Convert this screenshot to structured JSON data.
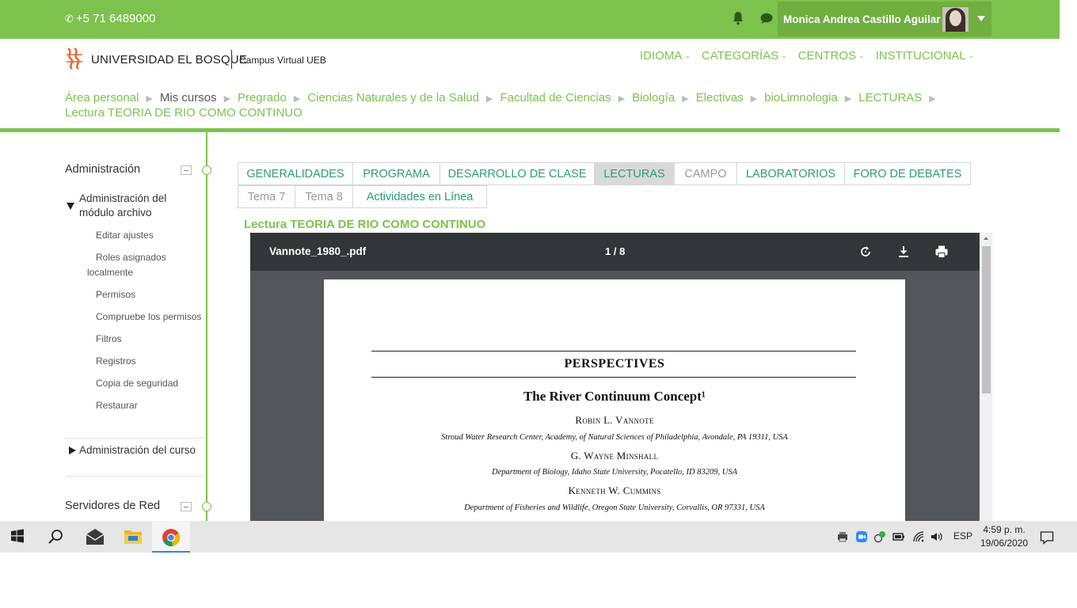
{
  "topbar": {
    "phone": "+5 71 6489000",
    "user_name": "Monica Andrea Castillo Aguilar",
    "bell_icon": "bell-icon",
    "chat_icon": "chat-bubble-icon"
  },
  "header": {
    "logo_text_1": "UNIVERSIDAD",
    "logo_text_2": "EL BOSQUE",
    "campus": "Campus Virtual UEB",
    "nav": [
      {
        "label": "IDIOMA"
      },
      {
        "label": "CATEGORÍAS"
      },
      {
        "label": "CENTROS"
      },
      {
        "label": "INSTITUCIONAL"
      }
    ]
  },
  "breadcrumb": [
    {
      "label": "Área personal",
      "link": true
    },
    {
      "label": "Mis cursos",
      "link": false
    },
    {
      "label": "Pregrado",
      "link": true
    },
    {
      "label": "Ciencias Naturales y de la Salud",
      "link": true
    },
    {
      "label": "Facultad de Ciencias",
      "link": true
    },
    {
      "label": "Biología",
      "link": true
    },
    {
      "label": "Electivas",
      "link": true
    },
    {
      "label": "bioLimnologia",
      "link": true
    },
    {
      "label": "LECTURAS",
      "link": true
    },
    {
      "label": "Lectura TEORIA DE RIO COMO CONTINUO",
      "link": true
    }
  ],
  "sidebar": {
    "admin_title": "Administración",
    "module_admin": "Administración del módulo archivo",
    "module_links": [
      "Editar ajustes",
      "Roles asignados localmente",
      "Permisos",
      "Compruebe los permisos",
      "Filtros",
      "Registros",
      "Copia de seguridad",
      "Restaurar"
    ],
    "course_admin": "Administración del curso",
    "network_title": "Servidores de Red"
  },
  "tabs": {
    "row1": [
      {
        "label": "GENERALIDADES",
        "state": "normal"
      },
      {
        "label": "PROGRAMA",
        "state": "normal"
      },
      {
        "label": "DESARROLLO DE CLASE",
        "state": "normal"
      },
      {
        "label": "LECTURAS",
        "state": "active"
      },
      {
        "label": "CAMPO",
        "state": "disabled"
      },
      {
        "label": "LABORATORIOS",
        "state": "normal"
      },
      {
        "label": "FORO DE DEBATES",
        "state": "normal"
      }
    ],
    "row2": [
      {
        "label": "Tema 7",
        "state": "disabled"
      },
      {
        "label": "Tema 8",
        "state": "disabled"
      },
      {
        "label": "Actividades en Línea",
        "state": "normal"
      }
    ]
  },
  "page_title": "Lectura TEORIA DE RIO COMO CONTINUO",
  "pdf": {
    "file_name": "Vannote_1980_.pdf",
    "page_indicator": "1 / 8",
    "buttons": [
      "rotate-icon",
      "download-icon",
      "print-icon"
    ],
    "section": "PERSPECTIVES",
    "title": "The River Continuum Concept¹",
    "authors": [
      {
        "name": "Robin L. Vannote",
        "affiliation": "Stroud Water Research Center, Academy, of Natural Sciences of Philadelphia, Avondale, PA 19311, USA"
      },
      {
        "name": "G. Wayne Minshall",
        "affiliation": "Department of Biology, Idaho State University, Pocatello, ID 83209, USA"
      },
      {
        "name": "Kenneth W. Cummins",
        "affiliation": "Department of Fisheries and Wildlife, Oregon State University, Corvallis, OR 97331, USA"
      }
    ]
  },
  "taskbar": {
    "apps": [
      "windows-start-icon",
      "search-icon",
      "mail-icon",
      "file-explorer-icon",
      "chrome-icon"
    ],
    "language": "ESP",
    "time": "4:59 p. m.",
    "date": "19/06/2020"
  },
  "colors": {
    "brand_green": "#7dc24d",
    "tab_teal": "#2e9a7c",
    "pdf_toolbar": "#323639"
  }
}
